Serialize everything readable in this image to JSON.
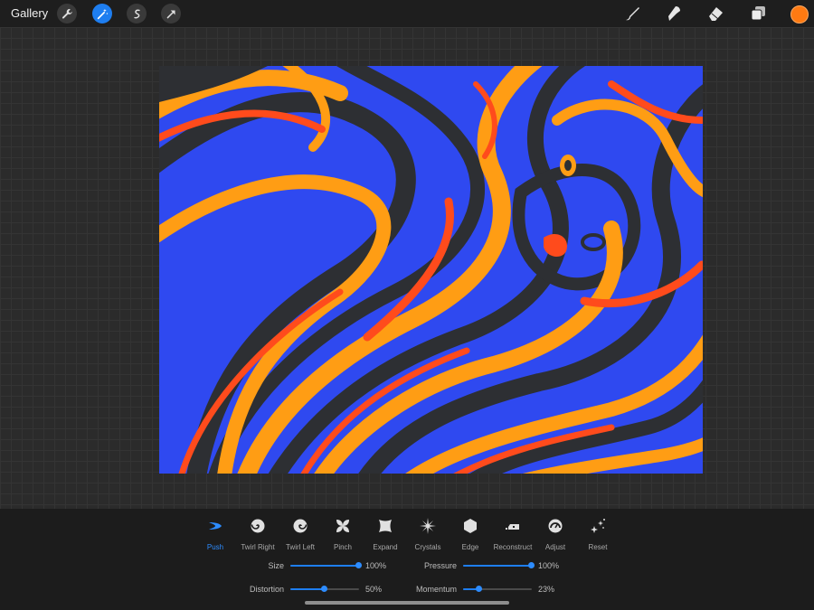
{
  "topbar": {
    "gallery_label": "Gallery",
    "left_tools": [
      "wrench-icon",
      "magic-wand-icon",
      "selection-icon",
      "transform-arrow-icon"
    ],
    "active_left_tool": "magic-wand-icon",
    "right_tools": [
      "brush-icon",
      "smudge-icon",
      "eraser-icon",
      "layers-icon"
    ],
    "current_color": "#ff7a12"
  },
  "canvas": {
    "colors": [
      "#2f49f0",
      "#ff9d14",
      "#ff4b1c",
      "#2d2f33"
    ]
  },
  "liquify": {
    "modes": [
      {
        "label": "Push",
        "icon": "push-icon"
      },
      {
        "label": "Twirl Right",
        "icon": "twirl-right-icon"
      },
      {
        "label": "Twirl Left",
        "icon": "twirl-left-icon"
      },
      {
        "label": "Pinch",
        "icon": "pinch-icon"
      },
      {
        "label": "Expand",
        "icon": "expand-icon"
      },
      {
        "label": "Crystals",
        "icon": "crystals-icon"
      },
      {
        "label": "Edge",
        "icon": "edge-icon"
      },
      {
        "label": "Reconstruct",
        "icon": "reconstruct-icon"
      },
      {
        "label": "Adjust",
        "icon": "adjust-icon"
      },
      {
        "label": "Reset",
        "icon": "reset-icon"
      }
    ],
    "active_mode": "Push",
    "sliders": {
      "size": {
        "label": "Size",
        "value_text": "100%",
        "value": 1.0
      },
      "pressure": {
        "label": "Pressure",
        "value_text": "100%",
        "value": 1.0
      },
      "distortion": {
        "label": "Distortion",
        "value_text": "50%",
        "value": 0.5
      },
      "momentum": {
        "label": "Momentum",
        "value_text": "23%",
        "value": 0.23
      }
    }
  },
  "accent_color": "#1e7ef0"
}
